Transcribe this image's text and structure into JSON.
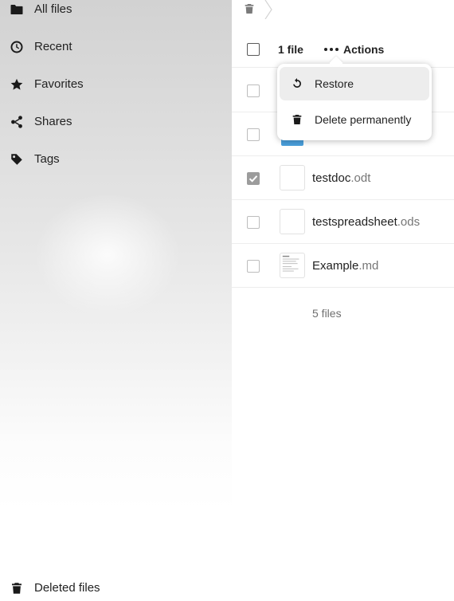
{
  "sidebar": {
    "items": [
      {
        "label": "All files",
        "icon": "folder-icon"
      },
      {
        "label": "Recent",
        "icon": "clock-icon"
      },
      {
        "label": "Favorites",
        "icon": "star-icon"
      },
      {
        "label": "Shares",
        "icon": "share-icon"
      },
      {
        "label": "Tags",
        "icon": "tag-icon"
      }
    ],
    "deleted_files": {
      "label": "Deleted files",
      "icon": "trash-icon"
    }
  },
  "breadcrumb": {
    "icon": "trash-icon"
  },
  "selection": {
    "count_label": "1 file",
    "actions_label": "Actions"
  },
  "actions_menu": {
    "items": [
      {
        "label": "Restore",
        "icon": "restore-icon"
      },
      {
        "label": "Delete permanently",
        "icon": "trash-icon"
      }
    ]
  },
  "files": [
    {
      "name": "",
      "ext": "",
      "checked": false
    },
    {
      "name": "",
      "ext": "",
      "checked": false,
      "icon": "folder-icon"
    },
    {
      "name": "testdoc",
      "ext": ".odt",
      "checked": true
    },
    {
      "name": "testspreadsheet",
      "ext": ".ods",
      "checked": false
    },
    {
      "name": "Example",
      "ext": ".md",
      "checked": false
    }
  ],
  "footer": {
    "count_label": "5 files"
  },
  "colors": {
    "folder_blue": "#4a9fdc",
    "checked_gray": "#9c9c9c",
    "menu_hover": "#ededed"
  }
}
